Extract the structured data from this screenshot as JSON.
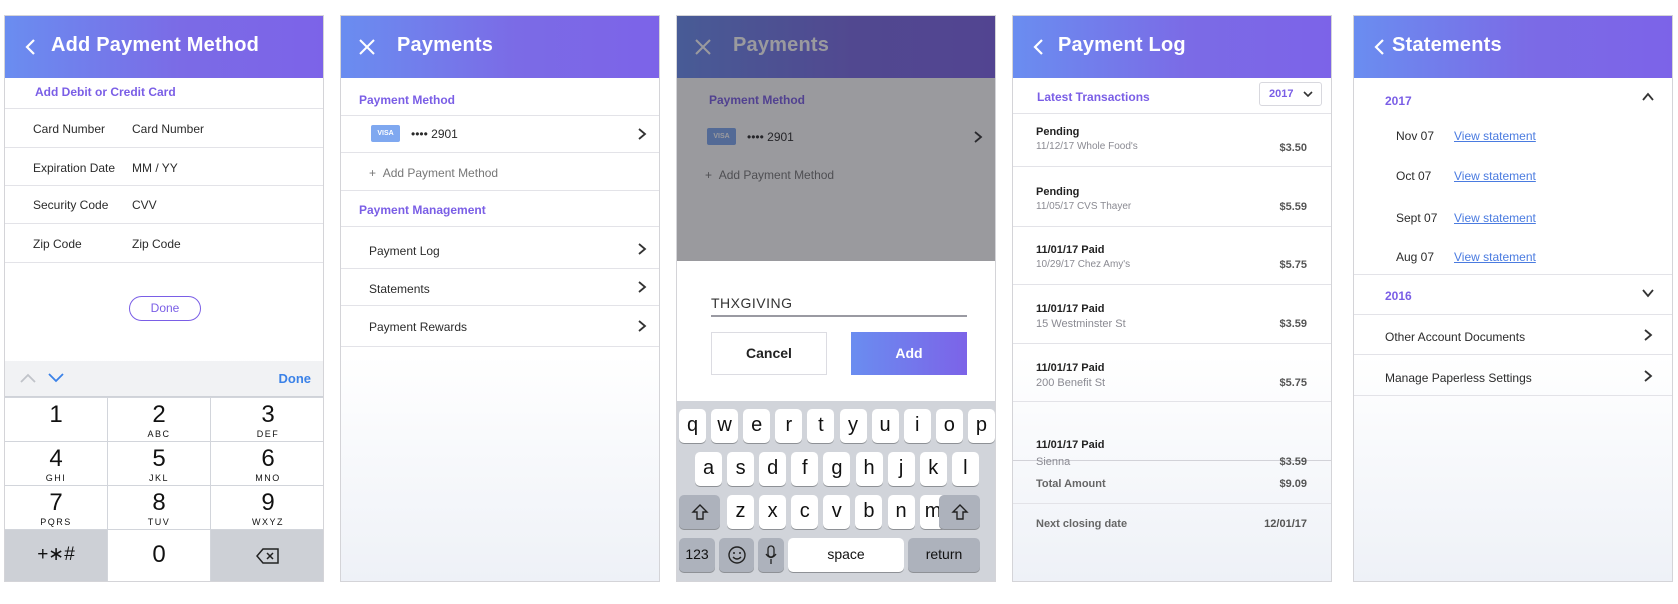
{
  "colors": {
    "header_gradient_start": "#6a8df0",
    "header_gradient_end": "#7c63e8",
    "accent": "#7a5ee6",
    "link": "#4a7be0"
  },
  "screen1": {
    "title": "Add Payment Method",
    "section": "Add Debit or Credit Card",
    "fields": [
      {
        "label": "Card Number",
        "placeholder": "Card Number"
      },
      {
        "label": "Expiration Date",
        "placeholder": "MM / YY"
      },
      {
        "label": "Security Code",
        "placeholder": "CVV"
      },
      {
        "label": "Zip Code",
        "placeholder": "Zip Code"
      }
    ],
    "done_button": "Done",
    "keypad_done": "Done",
    "keys": [
      {
        "n": "1",
        "s": ""
      },
      {
        "n": "2",
        "s": "ABC"
      },
      {
        "n": "3",
        "s": "DEF"
      },
      {
        "n": "4",
        "s": "GHI"
      },
      {
        "n": "5",
        "s": "JKL"
      },
      {
        "n": "6",
        "s": "MNO"
      },
      {
        "n": "7",
        "s": "PQRS"
      },
      {
        "n": "8",
        "s": "TUV"
      },
      {
        "n": "9",
        "s": "WXYZ"
      }
    ],
    "symbols_key": "+∗#",
    "zero_key": "0"
  },
  "screen2": {
    "title": "Payments",
    "payment_method_section": "Payment Method",
    "card_brand": "VISA",
    "card_masked": "•••• 2901",
    "add_method": "Add Payment Method",
    "add_plus": "+",
    "management_section": "Payment Management",
    "items": [
      "Payment Log",
      "Statements",
      "Payment Rewards"
    ]
  },
  "screen3": {
    "title": "Payments",
    "payment_method_section": "Payment Method",
    "card_brand": "VISA",
    "card_masked": "•••• 2901",
    "add_method": "Add Payment Method",
    "add_plus": "+",
    "input_value": "THXGIVING",
    "cancel_button": "Cancel",
    "add_button": "Add",
    "keyboard": {
      "row1": [
        "q",
        "w",
        "e",
        "r",
        "t",
        "y",
        "u",
        "i",
        "o",
        "p"
      ],
      "row2": [
        "a",
        "s",
        "d",
        "f",
        "g",
        "h",
        "j",
        "k",
        "l"
      ],
      "row3": [
        "z",
        "x",
        "c",
        "v",
        "b",
        "n",
        "m"
      ],
      "numbers_key": "123",
      "space_key": "space",
      "return_key": "return"
    }
  },
  "screen4": {
    "title": "Payment Log",
    "section": "Latest Transactions",
    "year": "2017",
    "transactions": [
      {
        "title": "Pending",
        "detail": "11/12/17 Whole Food's",
        "amount": "$3.50"
      },
      {
        "title": "Pending",
        "detail": "11/05/17 CVS Thayer",
        "amount": "$5.59"
      },
      {
        "title": "11/01/17 Paid",
        "detail": "10/29/17 Chez Amy's",
        "amount": "$5.75"
      },
      {
        "title": "11/01/17 Paid",
        "detail": "15 Westminster St",
        "amount": "$3.59"
      },
      {
        "title": "11/01/17 Paid",
        "detail": "200 Benefit St",
        "amount": "$5.75"
      },
      {
        "title": "11/01/17 Paid",
        "detail": "Sienna",
        "amount": "$3.59"
      }
    ],
    "total_label": "Total Amount",
    "total_value": "$9.09",
    "closing_label": "Next closing date",
    "closing_value": "12/01/17"
  },
  "screen5": {
    "title": "Statements",
    "year_open": "2017",
    "statements": [
      {
        "month": "Nov 07",
        "link": "View statement"
      },
      {
        "month": "Oct 07",
        "link": "View statement"
      },
      {
        "month": "Sept 07",
        "link": "View statement"
      },
      {
        "month": "Aug 07",
        "link": "View statement"
      }
    ],
    "year_closed": "2016",
    "items": [
      "Other Account Documents",
      "Manage Paperless Settings"
    ]
  }
}
